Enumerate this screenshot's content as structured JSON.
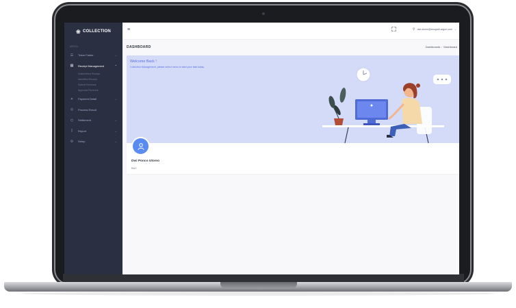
{
  "sidebar": {
    "brand": "COLLECTION",
    "menu_title": "MENU",
    "items": [
      {
        "label": "Tukar Faktur",
        "icon": "list-icon"
      },
      {
        "label": "Receipt Management",
        "icon": "receipt-icon",
        "active": true
      },
      {
        "label": "Payment Detail",
        "icon": "payment-icon"
      },
      {
        "label": "Process Result",
        "icon": "process-icon"
      },
      {
        "label": "Settlement",
        "icon": "settlement-icon"
      },
      {
        "label": "Report",
        "icon": "report-icon"
      },
      {
        "label": "Setup",
        "icon": "gear-icon"
      }
    ],
    "subitems": [
      "Unidentified Receipt",
      "Identified Receipt",
      "Submit Reversal",
      "Approval Reversal"
    ]
  },
  "topbar": {
    "user_email": "dwi.utomo@anugrah-argon.com"
  },
  "page": {
    "title": "DASHBOARD",
    "breadcrumb": [
      "Dashboards",
      "Dashboard"
    ]
  },
  "welcome": {
    "title": "Welcome Back !",
    "subtitle": "Collection Management, please select menu to start your task today.",
    "user_name": "Dwi Ponco Utomo",
    "user_role": "BAC"
  },
  "colors": {
    "sidebar": "#2a3042",
    "accent": "#556ee6",
    "hero_bg": "#d4dbf9",
    "avatar": "#5a8bf2"
  }
}
